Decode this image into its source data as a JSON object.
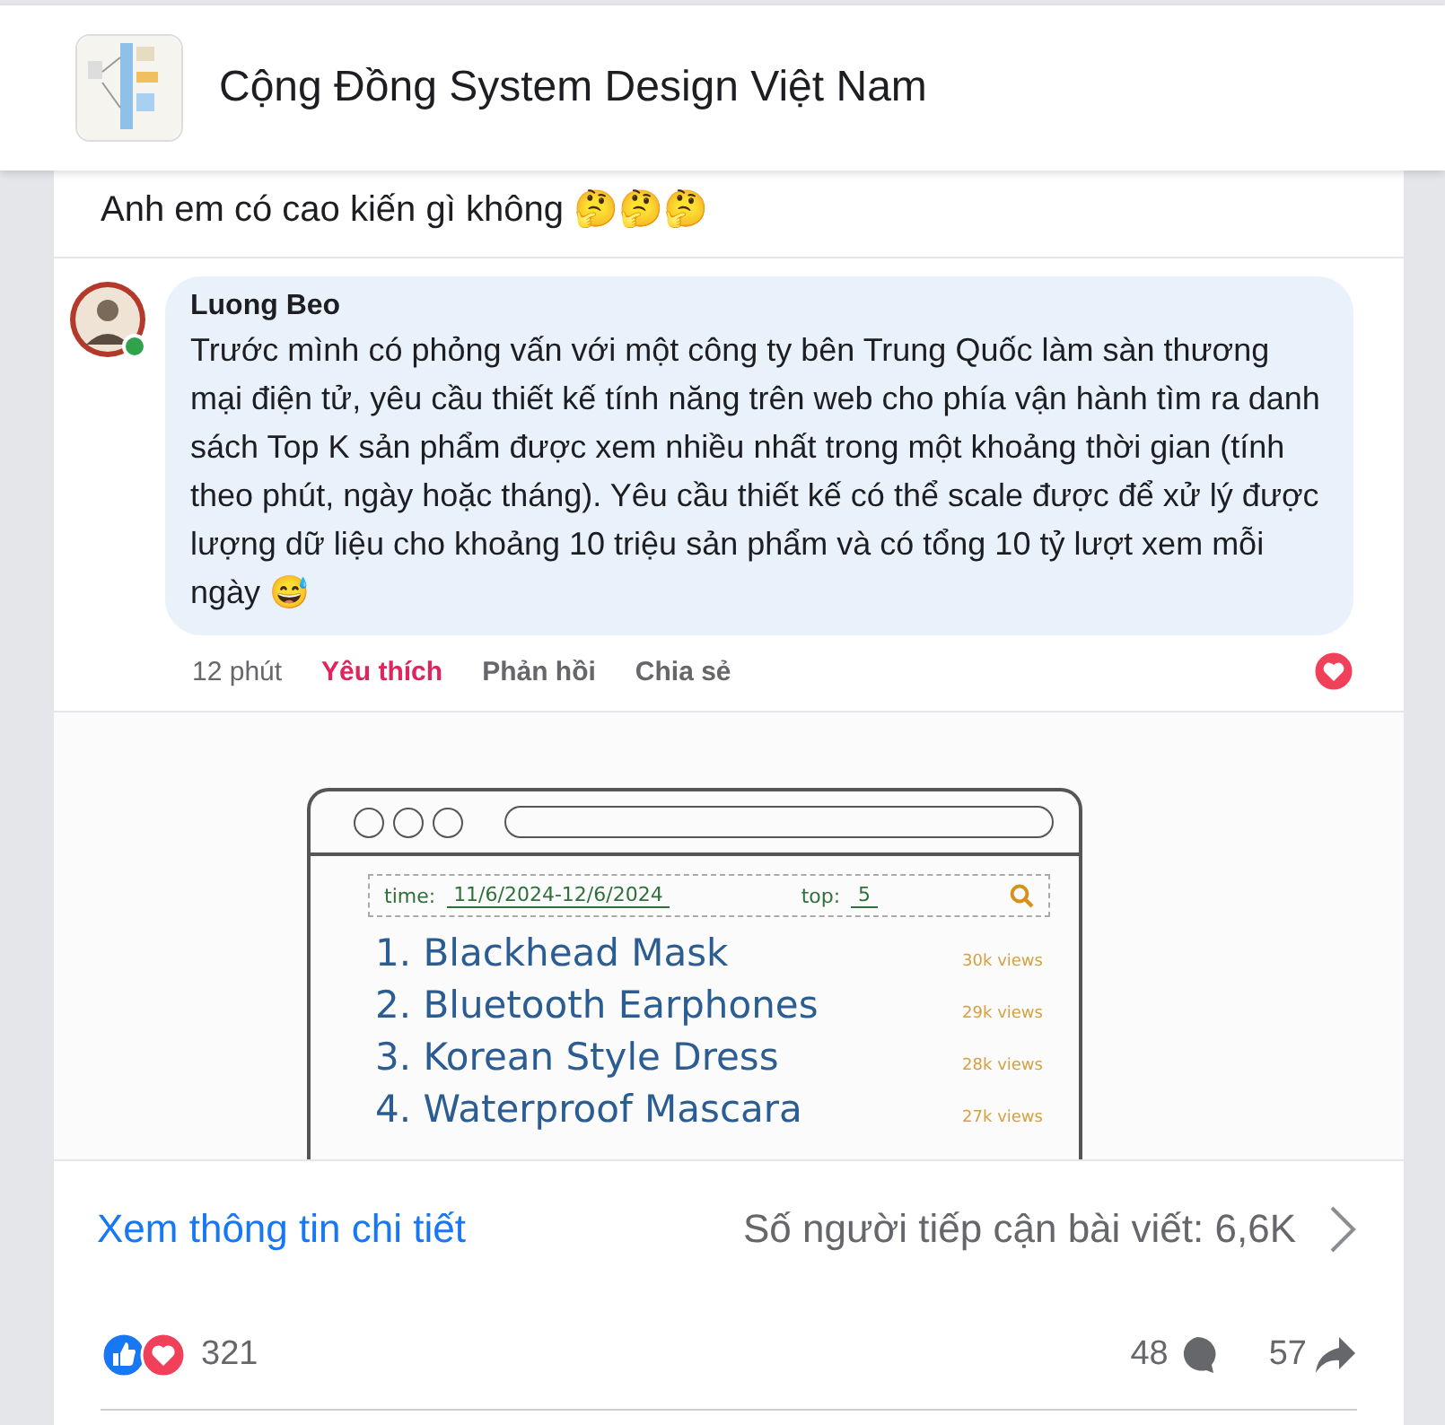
{
  "group": {
    "name": "Cộng Đồng System Design Việt Nam"
  },
  "post": {
    "caption": "Anh em có cao kiến gì không 🤔🤔🤔"
  },
  "comment": {
    "author": "Luong Beo",
    "online": true,
    "text": "Trước mình có phỏng vấn với một công ty bên Trung Quốc làm sàn thương mại điện tử, yêu cầu thiết kế tính năng trên web cho phía vận hành tìm ra danh sách Top K sản phẩm được xem nhiều nhất trong một khoảng thời gian (tính theo phút, ngày hoặc tháng). Yêu cầu thiết kế có thể scale được để xử lý được lượng dữ liệu cho khoảng 10 triệu sản phẩm và có tổng 10 tỷ lượt xem mỗi ngày 😅",
    "actions": [
      {
        "kind": "time",
        "label": "12 phút"
      },
      {
        "kind": "like",
        "label": "Yêu thích",
        "selected": true
      },
      {
        "kind": "action",
        "label": "Phản hồi"
      },
      {
        "kind": "action",
        "label": "Chia sẻ"
      }
    ]
  },
  "sketch": {
    "time_label": "time:",
    "time_value": "11/6/2024-12/6/2024",
    "top_label": "top:",
    "top_value": "5",
    "items": [
      {
        "name": "1. Blackhead Mask",
        "views": "30k views"
      },
      {
        "name": "2. Bluetooth Earphones",
        "views": "29k views"
      },
      {
        "name": "3. Korean Style Dress",
        "views": "28k views"
      },
      {
        "name": "4. Waterproof Mascara",
        "views": "27k views"
      }
    ]
  },
  "insights": {
    "link": "Xem thông tin chi tiết",
    "reach": "Số người tiếp cận bài viết: 6,6K"
  },
  "stats": {
    "reactions": "321",
    "comments": "48",
    "shares": "57"
  }
}
